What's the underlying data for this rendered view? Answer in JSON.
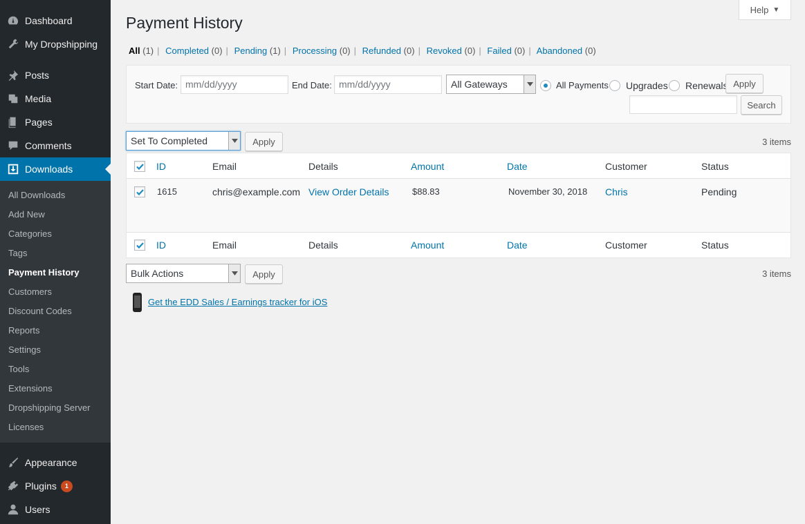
{
  "sidebar": {
    "top_items": [
      {
        "label": "Dashboard",
        "icon": "dashboard-icon"
      },
      {
        "label": "My Dropshipping",
        "icon": "wrench-icon"
      }
    ],
    "content_items": [
      {
        "label": "Posts",
        "icon": "pin-icon"
      },
      {
        "label": "Media",
        "icon": "media-icon"
      },
      {
        "label": "Pages",
        "icon": "pages-icon"
      },
      {
        "label": "Comments",
        "icon": "comment-icon"
      },
      {
        "label": "Downloads",
        "icon": "download-icon"
      }
    ],
    "submenu": [
      "All Downloads",
      "Add New",
      "Categories",
      "Tags",
      "Payment History",
      "Customers",
      "Discount Codes",
      "Reports",
      "Settings",
      "Tools",
      "Extensions",
      "Dropshipping Server",
      "Licenses"
    ],
    "bottom_items": [
      {
        "label": "Appearance",
        "icon": "brush-icon"
      },
      {
        "label": "Plugins",
        "icon": "plugin-icon",
        "badge": "1"
      },
      {
        "label": "Users",
        "icon": "user-icon"
      }
    ],
    "accent_color": "#0073aa"
  },
  "help": {
    "label": "Help"
  },
  "page": {
    "title": "Payment History"
  },
  "status_filters": [
    {
      "label": "All",
      "count": "(1)"
    },
    {
      "label": "Completed",
      "count": "(0)"
    },
    {
      "label": "Pending",
      "count": "(1)"
    },
    {
      "label": "Processing",
      "count": "(0)"
    },
    {
      "label": "Refunded",
      "count": "(0)"
    },
    {
      "label": "Revoked",
      "count": "(0)"
    },
    {
      "label": "Failed",
      "count": "(0)"
    },
    {
      "label": "Abandoned",
      "count": "(0)"
    }
  ],
  "filters": {
    "start_date_label": "Start Date:",
    "start_date_placeholder": "mm/dd/yyyy",
    "end_date_label": "End Date:",
    "end_date_placeholder": "mm/dd/yyyy",
    "gateway_selected": "All Gateways",
    "radio_all": "All Payments",
    "radio_upgrades": "Upgrades",
    "radio_renewals": "Renewals",
    "apply_label": "Apply",
    "search_label": "Search"
  },
  "bulk_top": {
    "selected": "Set To Completed",
    "apply_label": "Apply",
    "items_count": "3 items"
  },
  "bulk_bottom": {
    "selected": "Bulk Actions",
    "apply_label": "Apply",
    "items_count": "3 items"
  },
  "table": {
    "columns": {
      "id": "ID",
      "email": "Email",
      "details": "Details",
      "amount": "Amount",
      "date": "Date",
      "customer": "Customer",
      "status": "Status"
    },
    "rows": [
      {
        "id": "1615",
        "email": "chris@example.com",
        "details": "View Order Details",
        "amount": "$88.83",
        "date": "November 30, 2018",
        "customer": "Chris",
        "status": "Pending"
      }
    ]
  },
  "ios_link": "Get the EDD Sales / Earnings tracker for iOS"
}
